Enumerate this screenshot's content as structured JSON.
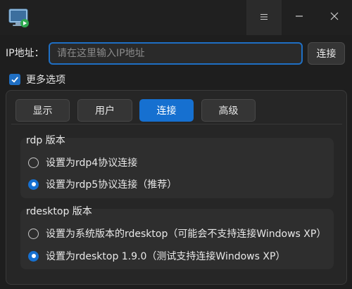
{
  "titlebar": {
    "app_icon": "remote-desktop-icon",
    "menu_icon": "hamburger-menu-icon",
    "minimize_icon": "minimize-icon",
    "close_icon": "close-icon"
  },
  "connection": {
    "ip_label": "IP地址：",
    "ip_placeholder": "请在这里输入IP地址",
    "ip_value": "",
    "connect_label": "连接"
  },
  "more_options": {
    "label": "更多选项",
    "checked": true
  },
  "tabs": [
    {
      "label": "显示",
      "active": false
    },
    {
      "label": "用户",
      "active": false
    },
    {
      "label": "连接",
      "active": true
    },
    {
      "label": "高级",
      "active": false
    }
  ],
  "rdp_group": {
    "title": "rdp 版本",
    "options": [
      {
        "label": "设置为rdp4协议连接",
        "selected": false
      },
      {
        "label": "设置为rdp5协议连接（推荐）",
        "selected": true
      }
    ]
  },
  "rdesktop_group": {
    "title": "rdesktop 版本",
    "options": [
      {
        "label": "设置为系统版本的rdesktop（可能会不支持连接Windows XP）",
        "selected": false
      },
      {
        "label": "设置为rdesktop 1.9.0（测试支持连接Windows XP）",
        "selected": true
      }
    ]
  },
  "colors": {
    "accent": "#1670d0",
    "background": "#1e1e1e",
    "panel": "#262626"
  }
}
